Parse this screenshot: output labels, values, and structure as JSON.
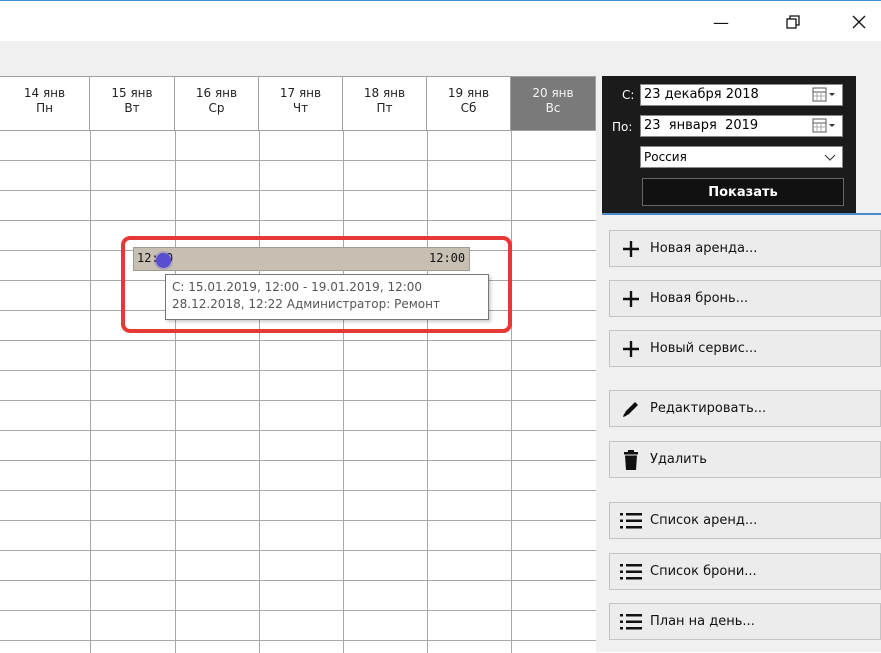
{
  "window": {
    "minimize_glyph": "—",
    "restore_glyph": "❐",
    "close_glyph": "✕"
  },
  "calendar": {
    "days": [
      {
        "date": "14 янв",
        "weekday": "Пн"
      },
      {
        "date": "15 янв",
        "weekday": "Вт"
      },
      {
        "date": "16 янв",
        "weekday": "Ср"
      },
      {
        "date": "17 янв",
        "weekday": "Чт"
      },
      {
        "date": "18 янв",
        "weekday": "Пт"
      },
      {
        "date": "19 янв",
        "weekday": "Сб"
      },
      {
        "date": "20 янв",
        "weekday": "Вс"
      }
    ],
    "rental": {
      "start_time": "12:00",
      "end_time": "12:00",
      "tooltip_line1": "С: 15.01.2019, 12:00 - 19.01.2019, 12:00",
      "tooltip_line2": "28.12.2018, 12:22 Администратор: Ремонт"
    }
  },
  "filter": {
    "from_label": "С:",
    "from_date": "23 декабря 2018",
    "to_label": "По:",
    "to_date": "23  января  2019",
    "country": "Россия",
    "show_label": "Показать"
  },
  "actions": {
    "new_rental": "Новая аренда...",
    "new_booking": "Новая бронь...",
    "new_service": "Новый сервис...",
    "edit": "Редактировать...",
    "delete": "Удалить",
    "rental_list": "Список аренд...",
    "booking_list": "Список брони...",
    "day_plan": "План на день..."
  },
  "colors": {
    "highlight": "#e53935",
    "accent": "#4c89c9",
    "panel_dark": "#1b1b1b",
    "rental_bar": "#c7bfb2"
  }
}
